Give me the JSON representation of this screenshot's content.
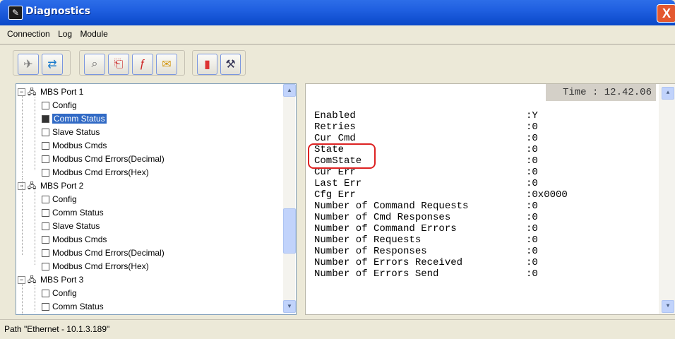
{
  "window": {
    "title": "Diagnostics",
    "close_glyph": "X"
  },
  "menu": [
    "Connection",
    "Log",
    "Module"
  ],
  "toolbar": {
    "groups": [
      [
        "disconnect-icon",
        "connect-icon"
      ],
      [
        "find-icon",
        "open-log-icon",
        "save-log-icon",
        "mail-icon"
      ],
      [
        "chart-icon",
        "tool-icon"
      ]
    ]
  },
  "tree": {
    "items": [
      {
        "label": "MBS Port 1",
        "level": 0,
        "expand": "−"
      },
      {
        "label": "Config",
        "level": 1
      },
      {
        "label": "Comm Status",
        "level": 1,
        "selected": true
      },
      {
        "label": "Slave Status",
        "level": 1
      },
      {
        "label": "Modbus Cmds",
        "level": 1
      },
      {
        "label": "Modbus Cmd Errors(Decimal)",
        "level": 1
      },
      {
        "label": "Modbus Cmd Errors(Hex)",
        "level": 1
      },
      {
        "label": "MBS Port 2",
        "level": 0,
        "expand": "−"
      },
      {
        "label": "Config",
        "level": 1
      },
      {
        "label": "Comm Status",
        "level": 1
      },
      {
        "label": "Slave Status",
        "level": 1
      },
      {
        "label": "Modbus Cmds",
        "level": 1
      },
      {
        "label": "Modbus Cmd Errors(Decimal)",
        "level": 1
      },
      {
        "label": "Modbus Cmd Errors(Hex)",
        "level": 1
      },
      {
        "label": "MBS Port 3",
        "level": 0,
        "expand": "−"
      },
      {
        "label": "Config",
        "level": 1
      },
      {
        "label": "Comm Status",
        "level": 1
      }
    ]
  },
  "detail": {
    "time": "Time : 12.42.06",
    "rows": [
      {
        "label": "Enabled",
        "value": ":Y"
      },
      {
        "label": "Retries",
        "value": ":0"
      },
      {
        "label": "Cur Cmd",
        "value": ":0"
      },
      {
        "label": "State",
        "value": ":0"
      },
      {
        "label": "ComState",
        "value": ":0"
      },
      {
        "label": "Cur Err",
        "value": ":0"
      },
      {
        "label": "Last Err",
        "value": ":0"
      },
      {
        "label": "Cfg Err",
        "value": ":0x0000"
      },
      {
        "label": "Number of Command Requests",
        "value": ":0"
      },
      {
        "label": "Number of Cmd Responses",
        "value": ":0"
      },
      {
        "label": "Number of Command Errors",
        "value": ":0"
      },
      {
        "label": "Number of Requests",
        "value": ":0"
      },
      {
        "label": "Number of Responses",
        "value": ":0"
      },
      {
        "label": "Number of Errors Received",
        "value": ":0"
      },
      {
        "label": "Number of Errors Send",
        "value": ":0"
      }
    ]
  },
  "status": {
    "path": "Path \"Ethernet - 10.1.3.189\""
  },
  "colors": {
    "titlebar": "#0a48c8",
    "selection": "#316ac5",
    "highlight": "#dd2222"
  }
}
